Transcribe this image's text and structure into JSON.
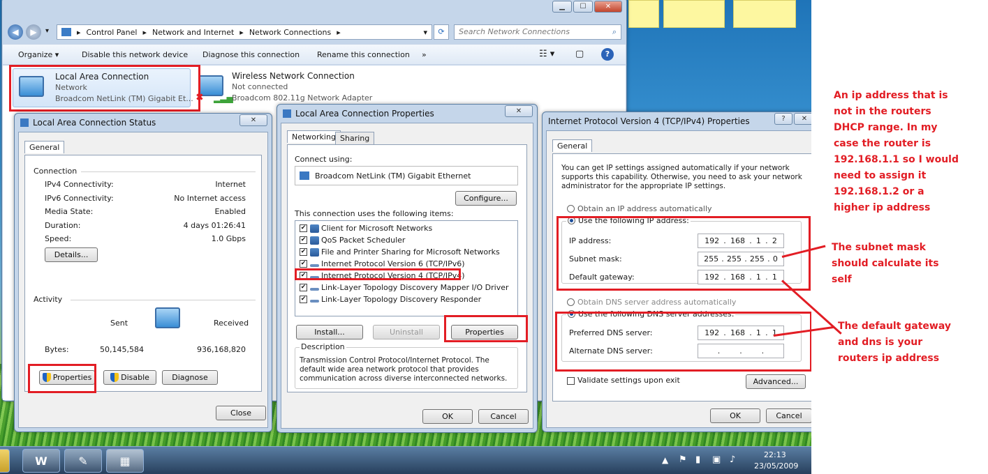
{
  "explorer": {
    "breadcrumb": [
      "Control Panel",
      "Network and Internet",
      "Network Connections"
    ],
    "search_placeholder": "Search Network Connections",
    "toolbar": [
      "Organize",
      "Disable this network device",
      "Diagnose this connection",
      "Rename this connection",
      "»"
    ],
    "connections": [
      {
        "name": "Local Area Connection",
        "status": "Network",
        "adapter": "Broadcom NetLink (TM) Gigabit Et..."
      },
      {
        "name": "Wireless Network Connection",
        "status": "Not connected",
        "adapter": "Broadcom 802.11g Network Adapter"
      }
    ]
  },
  "status_dlg": {
    "title": "Local Area Connection Status",
    "tab": "General",
    "connection_label": "Connection",
    "rows": [
      {
        "k": "IPv4 Connectivity:",
        "v": "Internet"
      },
      {
        "k": "IPv6 Connectivity:",
        "v": "No Internet access"
      },
      {
        "k": "Media State:",
        "v": "Enabled"
      },
      {
        "k": "Duration:",
        "v": "4 days 01:26:41"
      },
      {
        "k": "Speed:",
        "v": "1.0 Gbps"
      }
    ],
    "details_btn": "Details...",
    "activity_label": "Activity",
    "sent_label": "Sent",
    "received_label": "Received",
    "bytes_label": "Bytes:",
    "sent": "50,145,584",
    "received": "936,168,820",
    "properties_btn": "Properties",
    "disable_btn": "Disable",
    "diagnose_btn": "Diagnose",
    "close_btn": "Close"
  },
  "props_dlg": {
    "title": "Local Area Connection Properties",
    "tab_networking": "Networking",
    "tab_sharing": "Sharing",
    "connect_using": "Connect using:",
    "adapter": "Broadcom NetLink (TM) Gigabit Ethernet",
    "configure_btn": "Configure...",
    "items_label": "This connection uses the following items:",
    "items": [
      "Client for Microsoft Networks",
      "QoS Packet Scheduler",
      "File and Printer Sharing for Microsoft Networks",
      "Internet Protocol Version 6 (TCP/IPv6)",
      "Internet Protocol Version 4 (TCP/IPv4)",
      "Link-Layer Topology Discovery Mapper I/O Driver",
      "Link-Layer Topology Discovery Responder"
    ],
    "install_btn": "Install...",
    "uninstall_btn": "Uninstall",
    "properties_btn": "Properties",
    "description_label": "Description",
    "description": "Transmission Control Protocol/Internet Protocol. The default wide area network protocol that provides communication across diverse interconnected networks.",
    "ok_btn": "OK",
    "cancel_btn": "Cancel"
  },
  "ipv4_dlg": {
    "title": "Internet Protocol Version 4 (TCP/IPv4) Properties",
    "tab": "General",
    "intro": "You can get IP settings assigned automatically if your network supports this capability. Otherwise, you need to ask your network administrator for the appropriate IP settings.",
    "auto_ip": "Obtain an IP address automatically",
    "use_ip": "Use the following IP address:",
    "ip_label": "IP address:",
    "ip": [
      "192",
      "168",
      "1",
      "2"
    ],
    "mask_label": "Subnet mask:",
    "mask": [
      "255",
      "255",
      "255",
      "0"
    ],
    "gw_label": "Default gateway:",
    "gw": [
      "192",
      "168",
      "1",
      "1"
    ],
    "auto_dns": "Obtain DNS server address automatically",
    "use_dns": "Use the following DNS server addresses:",
    "pdns_label": "Preferred DNS server:",
    "pdns": [
      "192",
      "168",
      "1",
      "1"
    ],
    "adns_label": "Alternate DNS server:",
    "validate": "Validate settings upon exit",
    "advanced_btn": "Advanced...",
    "ok_btn": "OK",
    "cancel_btn": "Cancel"
  },
  "annotations": {
    "a1": [
      "An ip address that is",
      "not in the routers",
      "DHCP range. In my",
      "case the router is",
      "192.168.1.1 so I would",
      "need to assign it",
      "192.168.1.2 or a",
      "higher ip address"
    ],
    "a2": [
      "The subnet mask",
      "should calculate its",
      "self"
    ],
    "a3": [
      "The default gateway",
      "and dns is your",
      "routers ip address"
    ]
  },
  "taskbar": {
    "time": "22:13",
    "date": "23/05/2009"
  },
  "colors": {
    "highlight": "#e21d24",
    "accent": "#1a4d9a"
  }
}
